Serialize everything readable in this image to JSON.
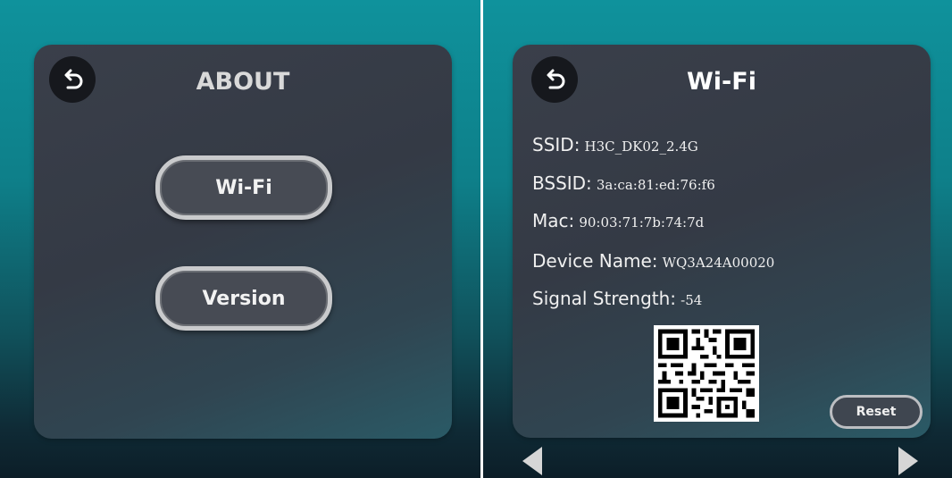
{
  "about_screen": {
    "title": "ABOUT",
    "back_icon": "undo-arrow-icon",
    "menu": [
      {
        "label": "Wi-Fi"
      },
      {
        "label": "Version"
      }
    ]
  },
  "wifi_screen": {
    "title": "Wi-Fi",
    "back_icon": "undo-arrow-icon",
    "fields": [
      {
        "label": "SSID:",
        "value": "H3C_DK02_2.4G"
      },
      {
        "label": "BSSID:",
        "value": "3a:ca:81:ed:76:f6"
      },
      {
        "label": "Mac:",
        "value": "90:03:71:7b:74:7d"
      },
      {
        "label": "Device Name:",
        "value": "WQ3A24A00020"
      },
      {
        "label": "Signal Strength:",
        "value": "-54"
      }
    ],
    "qr_icon": "qr-code-icon",
    "reset_label": "Reset",
    "nav": {
      "prev_icon": "triangle-left-icon",
      "next_icon": "triangle-right-icon"
    }
  },
  "colors": {
    "background_top": "#0f929c",
    "background_bottom": "#0c1e28",
    "card": "#3a3f4a",
    "button_border": "#c9cacc"
  }
}
